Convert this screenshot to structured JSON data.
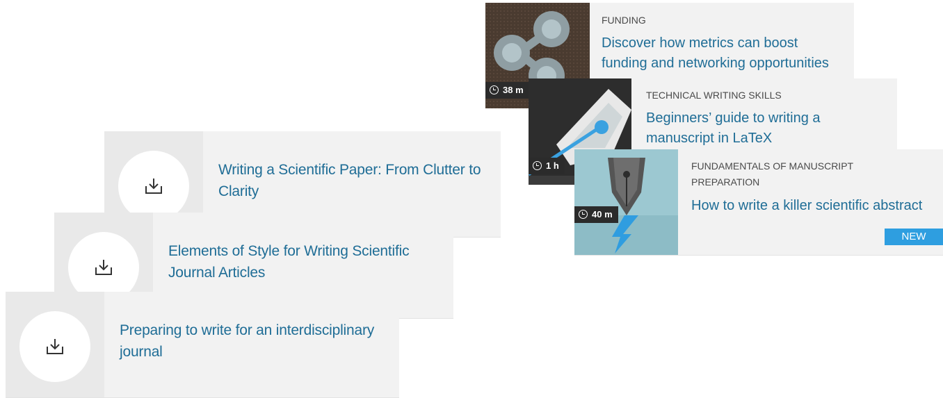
{
  "downloads": [
    {
      "title": "Writing a Scientific Paper: From Clutter to Clarity",
      "icon": "download-icon"
    },
    {
      "title": "Elements of Style for Writing Scientific Journal Articles",
      "icon": "download-icon"
    },
    {
      "title": "Preparing to write for an interdisciplinary journal",
      "icon": "download-icon"
    }
  ],
  "courses": [
    {
      "category": "FUNDING",
      "title": "Discover how metrics can boost funding and networking opportunities",
      "duration": "38 m"
    },
    {
      "category": "TECHNICAL WRITING SKILLS",
      "title": "Beginners’ guide to writing a manuscript in LaTeX",
      "duration": "1 h"
    },
    {
      "category": "FUNDAMENTALS OF MANUSCRIPT PREPARATION",
      "title": "How to write a killer scientific abstract",
      "duration": "40 m",
      "badge": "NEW"
    }
  ],
  "colors": {
    "link": "#1f6d96",
    "card_bg": "#f2f2f2",
    "badge": "#2e9ee0"
  }
}
